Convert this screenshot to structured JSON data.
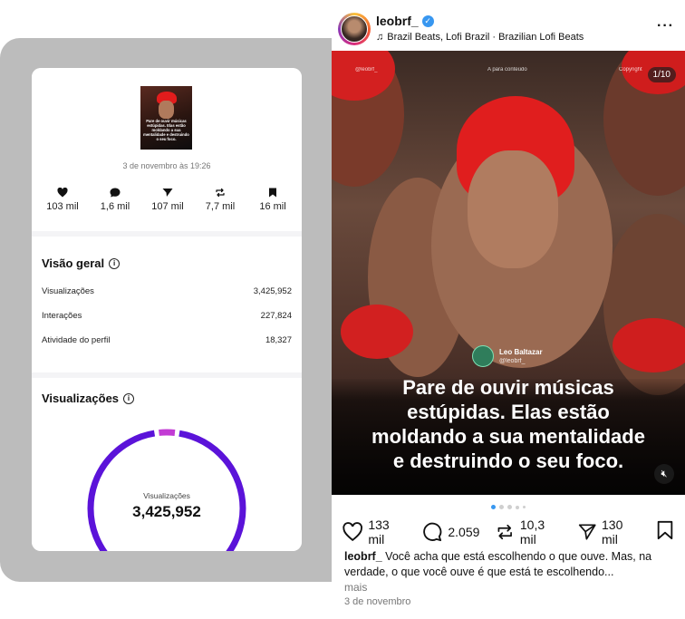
{
  "insights": {
    "thumbnail_caption": "Pare de ouvir músicas estúpidas. Elas estão moldando a sua mentalidade e destruindo o seu foco.",
    "post_date": "3 de novembro às 19:26",
    "stats": [
      {
        "icon": "heart-icon",
        "value": "103 mil"
      },
      {
        "icon": "comment-icon",
        "value": "1,6 mil"
      },
      {
        "icon": "share-icon",
        "value": "107 mil"
      },
      {
        "icon": "repost-icon",
        "value": "7,7 mil"
      },
      {
        "icon": "bookmark-icon",
        "value": "16 mil"
      }
    ],
    "overview": {
      "title": "Visão geral",
      "rows": [
        {
          "label": "Visualizações",
          "value": "3,425,952"
        },
        {
          "label": "Interações",
          "value": "227,824"
        },
        {
          "label": "Atividade do perfil",
          "value": "18,327"
        }
      ]
    },
    "views": {
      "title": "Visualizações",
      "donut_label": "Visualizações",
      "donut_value": "3,425,952",
      "colors": {
        "primary": "#5b13d9",
        "secondary": "#c23bd4"
      }
    }
  },
  "post": {
    "username": "leobrf_",
    "verified": true,
    "music": "Brazil Beats, Lofi Brazil · Brazilian Lofi Beats",
    "counter": "1/10",
    "tiny_left": "@leobrf_",
    "tiny_mid": "A para conteúdo",
    "tiny_right": "Copyright",
    "author_name": "Leo Baltazar",
    "author_handle": "@leobrf_",
    "overlay_text": "Pare de ouvir músicas estúpidas. Elas estão moldando a sua mentalidade e destruindo o seu foco.",
    "overlay_lines": [
      "Pare de ouvir músicas",
      "estúpidas. Elas estão",
      "moldando a sua mentalidade",
      "e destruindo o seu foco."
    ],
    "likes": "133 mil",
    "comments": "2.059",
    "reposts": "10,3 mil",
    "shares": "130 mil",
    "caption_user": "leobrf_",
    "caption_text": "Você acha que está escolhendo o que ouve. Mas, na verdade, o que você ouve é que está te escolhendo...",
    "more": "mais",
    "date": "3 de novembro",
    "accent": "#3897f0"
  }
}
